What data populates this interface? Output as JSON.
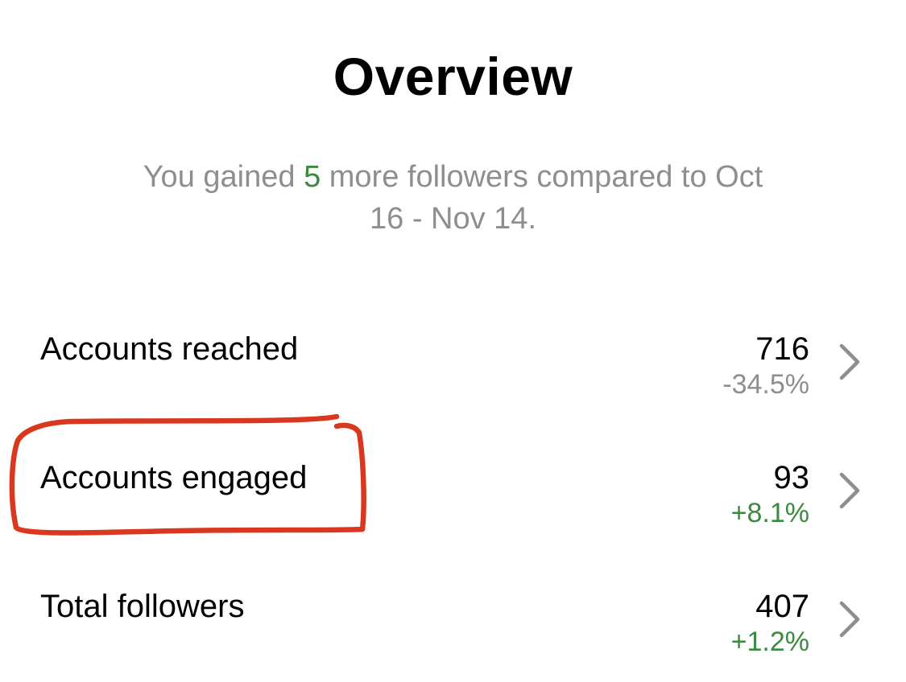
{
  "header": {
    "title": "Overview"
  },
  "summary": {
    "prefix": "You gained ",
    "highlight": "5",
    "suffix_line1": " more followers compared to Oct",
    "suffix_line2": "16 - Nov 14."
  },
  "metrics": [
    {
      "label": "Accounts reached",
      "value": "716",
      "change": "-34.5%",
      "trend": "negative"
    },
    {
      "label": "Accounts engaged",
      "value": "93",
      "change": "+8.1%",
      "trend": "positive"
    },
    {
      "label": "Total followers",
      "value": "407",
      "change": "+1.2%",
      "trend": "positive"
    }
  ],
  "colors": {
    "positive": "#3b8a3e",
    "negative": "#8e8e8e",
    "annotation": "#d9381e",
    "chevron": "#8e8e8e"
  },
  "icons": {
    "row_arrow": "chevron-right-icon"
  },
  "annotation": {
    "shape": "hand-drawn-rectangle",
    "target": "Accounts engaged"
  }
}
